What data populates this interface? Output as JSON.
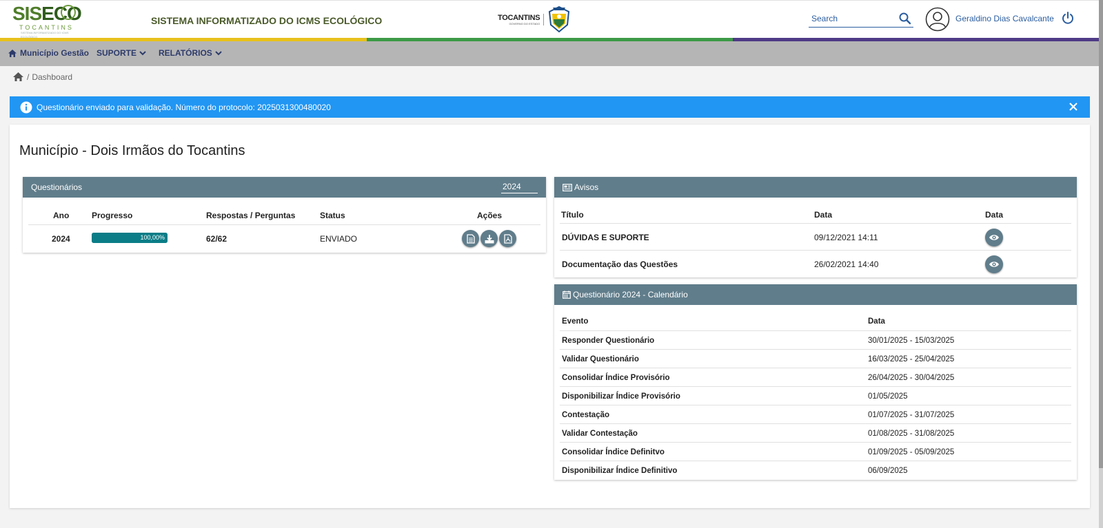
{
  "header": {
    "logo_main_left": "SIS",
    "logo_main_right": "ECO",
    "logo_sub": "TOCANTINS",
    "logo_tiny": "SISTEMA INFORMATIZADO DO ICMS ECOLÓGICO",
    "system_title": "SISTEMA INFORMATIZADO DO ICMS ECOLÓGICO",
    "gov_name": "TOCANTINS",
    "gov_sub": "GOVERNO DO ESTADO",
    "search_placeholder": "Search",
    "user_name": "Geraldino Dias Cavalcante",
    "stripe_colors": [
      "#e8c11b",
      "#3c9a46",
      "#4e3a86"
    ]
  },
  "nav": {
    "home_label": "Município Gestão",
    "support_label": "SUPORTE",
    "reports_label": "RELATÓRIOS"
  },
  "breadcrumb": {
    "current": "Dashboard"
  },
  "alert": {
    "message": "Questionário enviado para validação. Número do protocolo: 2025031300480020",
    "color": "#2196f3"
  },
  "page": {
    "title": "Município - Dois Irmãos do Tocantins"
  },
  "questionarios": {
    "title": "Questionários",
    "year_selected": "2024",
    "headers": {
      "ano": "Ano",
      "progresso": "Progresso",
      "respostas": "Respostas / Perguntas",
      "status": "Status",
      "acoes": "Ações"
    },
    "row": {
      "ano": "2024",
      "progress_percent": 100,
      "progress_label": "100,00%",
      "respostas": "62/62",
      "status": "ENVIADO"
    }
  },
  "avisos": {
    "title": "Avisos",
    "headers": {
      "titulo": "Título",
      "data": "Data",
      "data2": "Data"
    },
    "rows": [
      {
        "titulo": "DÚVIDAS E SUPORTE",
        "data": "09/12/2021 14:11"
      },
      {
        "titulo": "Documentação das Questões",
        "data": "26/02/2021 14:40"
      }
    ]
  },
  "calendario": {
    "title": "Questionário 2024 - Calendário",
    "headers": {
      "evento": "Evento",
      "data": "Data"
    },
    "rows": [
      {
        "evento": "Responder Questionário",
        "data": "30/01/2025 - 15/03/2025"
      },
      {
        "evento": "Validar Questionário",
        "data": "16/03/2025 - 25/04/2025"
      },
      {
        "evento": "Consolidar Índice Provisório",
        "data": "26/04/2025 - 30/04/2025"
      },
      {
        "evento": "Disponibilizar Índice Provisório",
        "data": "01/05/2025"
      },
      {
        "evento": "Contestação",
        "data": "01/07/2025 - 31/07/2025"
      },
      {
        "evento": "Validar Contestação",
        "data": "01/08/2025 - 31/08/2025"
      },
      {
        "evento": "Consolidar Índice Definitvo",
        "data": "01/09/2025 - 05/09/2025"
      },
      {
        "evento": "Disponibilizar Índice Definitivo",
        "data": "06/09/2025"
      }
    ]
  },
  "colors": {
    "panel_header": "#607d8b",
    "progress": "#00838f",
    "nav_bg": "#b5b5b5",
    "link_blue": "#2a5d9f"
  }
}
